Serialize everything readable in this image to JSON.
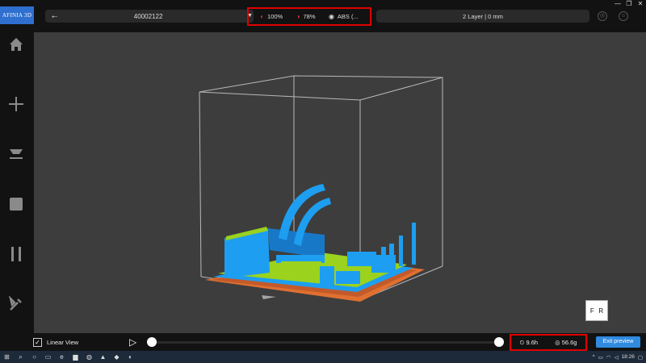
{
  "app": {
    "logo_text": "AFINIA 3D"
  },
  "window": {
    "minimize": "—",
    "restore": "❐",
    "close": "✕"
  },
  "printer": {
    "name": "40002122",
    "dropdown": "▼",
    "usb_icon": "usb-icon"
  },
  "status": {
    "nozzle": {
      "icon": "nozzle-icon",
      "value": "100%",
      "color": "#e03030"
    },
    "bed": {
      "icon": "bed-icon",
      "value": "78%",
      "color": "#e03030"
    },
    "material": {
      "icon": "material-icon",
      "value": "ABS (..."
    }
  },
  "layer": {
    "text": "2 Layer | 0 mm"
  },
  "sidebar": {
    "items": [
      {
        "name": "home",
        "icon": "home-icon"
      },
      {
        "name": "add",
        "icon": "plus-icon"
      },
      {
        "name": "print",
        "icon": "print-icon"
      },
      {
        "name": "stop",
        "icon": "stop-icon"
      },
      {
        "name": "pause",
        "icon": "pause-icon"
      },
      {
        "name": "tools",
        "icon": "wrench-icon"
      }
    ]
  },
  "view_cube": {
    "front": "F",
    "right": "R"
  },
  "preview": {
    "linear_view_label": "Linear View",
    "linear_view_checked": true,
    "progress": 1.0
  },
  "estimate": {
    "time": "9.6h",
    "weight": "56.6g"
  },
  "exit_button": "Exit preview",
  "taskbar": {
    "time": "18:26"
  },
  "colors": {
    "accent": "#2f8ae0",
    "highlight": "#e00000",
    "model_blue": "#1e9ef0",
    "model_green": "#9ad21e",
    "raft": "#e07030"
  }
}
